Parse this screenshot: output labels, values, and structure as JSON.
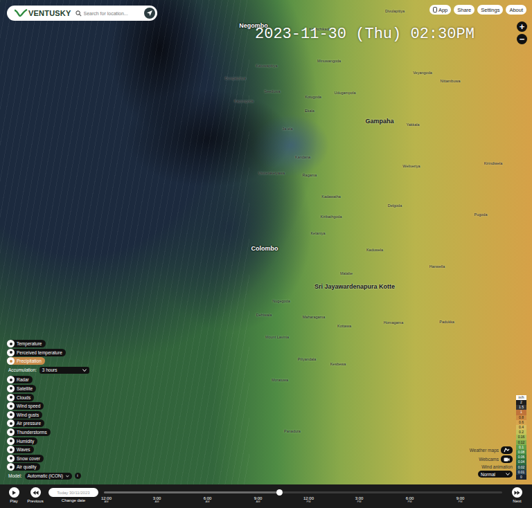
{
  "logo": {
    "text": "VENTUSKY"
  },
  "search": {
    "placeholder": "Search for location..."
  },
  "top_buttons": [
    {
      "label": "App"
    },
    {
      "label": "Share"
    },
    {
      "label": "Settings"
    },
    {
      "label": "About"
    }
  ],
  "zoom": [
    "+",
    "−"
  ],
  "timestamp": "2023-11-30 (Thu) 02:30PM",
  "places": [
    {
      "name": "Negombo",
      "kind": "major-sea"
    },
    {
      "name": "Divulapitiya",
      "kind": "town"
    },
    {
      "name": "Kochchikade",
      "kind": "town"
    },
    {
      "name": "Katuwapitiya",
      "kind": "town"
    },
    {
      "name": "Minuwangoda",
      "kind": "town"
    },
    {
      "name": "Veyangoda",
      "kind": "town"
    },
    {
      "name": "Dungalpitiya",
      "kind": "town"
    },
    {
      "name": "Seeduwa",
      "kind": "town"
    },
    {
      "name": "Udugampola",
      "kind": "town"
    },
    {
      "name": "Nittambuwa",
      "kind": "town"
    },
    {
      "name": "Kotugoda",
      "kind": "town"
    },
    {
      "name": "Kapungoda",
      "kind": "town"
    },
    {
      "name": "Ekala",
      "kind": "town"
    },
    {
      "name": "Gampaha",
      "kind": "major"
    },
    {
      "name": "Yakkala",
      "kind": "town"
    },
    {
      "name": "Ja-ela",
      "kind": "town"
    },
    {
      "name": "Kandana",
      "kind": "town"
    },
    {
      "name": "Uswetakeiyawa",
      "kind": "town"
    },
    {
      "name": "Ragama",
      "kind": "town"
    },
    {
      "name": "Weliveriya",
      "kind": "town"
    },
    {
      "name": "Kirindiwela",
      "kind": "town"
    },
    {
      "name": "Kadawatha",
      "kind": "town"
    },
    {
      "name": "Delgoda",
      "kind": "town"
    },
    {
      "name": "Pugoda",
      "kind": "town"
    },
    {
      "name": "Kiribathgoda",
      "kind": "town"
    },
    {
      "name": "Kelaniya",
      "kind": "town"
    },
    {
      "name": "Colombo",
      "kind": "major-sea"
    },
    {
      "name": "Kaduwela",
      "kind": "town"
    },
    {
      "name": "Hanwella",
      "kind": "town"
    },
    {
      "name": "Malabe",
      "kind": "town"
    },
    {
      "name": "Sri Jayawardenapura Kotte",
      "kind": "major"
    },
    {
      "name": "Nugegoda",
      "kind": "town"
    },
    {
      "name": "Dehiwala",
      "kind": "town"
    },
    {
      "name": "Maharagama",
      "kind": "town"
    },
    {
      "name": "Homagama",
      "kind": "town"
    },
    {
      "name": "Kottawa",
      "kind": "town"
    },
    {
      "name": "Padukka",
      "kind": "town"
    },
    {
      "name": "Mount Lavinia",
      "kind": "town"
    },
    {
      "name": "Piliyandala",
      "kind": "town"
    },
    {
      "name": "Kesbewa",
      "kind": "town"
    },
    {
      "name": "Moratuwa",
      "kind": "town"
    },
    {
      "name": "Panadura",
      "kind": "town"
    }
  ],
  "layers": [
    {
      "label": "Temperature",
      "selected": false
    },
    {
      "label": "Perceived temperature",
      "selected": false
    },
    {
      "label": "Precipitation",
      "selected": true
    },
    {
      "label": "Radar",
      "selected": false
    },
    {
      "label": "Satellite",
      "selected": false
    },
    {
      "label": "Clouds",
      "selected": false
    },
    {
      "label": "Wind speed",
      "selected": false
    },
    {
      "label": "Wind gusts",
      "selected": false
    },
    {
      "label": "Air pressure",
      "selected": false
    },
    {
      "label": "Thunderstorms",
      "selected": false
    },
    {
      "label": "Humidity",
      "selected": false
    },
    {
      "label": "Waves",
      "selected": false
    },
    {
      "label": "Snow cover",
      "selected": false
    },
    {
      "label": "Air quality",
      "selected": false
    }
  ],
  "accumulation": {
    "label": "Accumulation:",
    "value": "3 hours"
  },
  "model": {
    "label": "Model:",
    "value": "Automatic (ICON)",
    "info": "i"
  },
  "legend": {
    "unit": "in/h",
    "steps": [
      {
        "value": "2",
        "color": "#1e1e1e"
      },
      {
        "value": "1.5",
        "color": "#333333"
      },
      {
        "value": "1",
        "color": "#c0733a"
      },
      {
        "value": "0.8",
        "color": "#cf8c42"
      },
      {
        "value": "0.6",
        "color": "#d9a64e"
      },
      {
        "value": "0.4",
        "color": "#d8bd5c"
      },
      {
        "value": "0.2",
        "color": "#c4c45a"
      },
      {
        "value": "0.16",
        "color": "#a6bd55"
      },
      {
        "value": "0.12",
        "color": "#7fae4e"
      },
      {
        "value": "0.1",
        "color": "#5e9d48"
      },
      {
        "value": "0.08",
        "color": "#468c44"
      },
      {
        "value": "0.06",
        "color": "#367a40"
      },
      {
        "value": "0.04",
        "color": "#2c6a3e"
      },
      {
        "value": "0.02",
        "color": "#285248"
      },
      {
        "value": "0.01",
        "color": "#243a4c"
      },
      {
        "value": "0",
        "color": "#1a2230"
      }
    ]
  },
  "side_controls": [
    {
      "label": "Weather maps"
    },
    {
      "label": "Webcams"
    }
  ],
  "wind_animation": {
    "label": "Wind animation",
    "value": "Normal"
  },
  "timeline": {
    "play": "Play",
    "previous": "Previous",
    "date": "Today 30/11/2023",
    "change_date": "Change date",
    "next": "Next",
    "level": 0.44,
    "ticks": [
      {
        "time": "12:00",
        "period": "AM"
      },
      {
        "time": "3:00",
        "period": "AM"
      },
      {
        "time": "6:00",
        "period": "AM"
      },
      {
        "time": "9:00",
        "period": "AM"
      },
      {
        "time": "12:00",
        "period": "PM"
      },
      {
        "time": "3:00",
        "period": "PM"
      },
      {
        "time": "6:00",
        "period": "PM"
      },
      {
        "time": "9:00",
        "period": "PM"
      }
    ]
  }
}
